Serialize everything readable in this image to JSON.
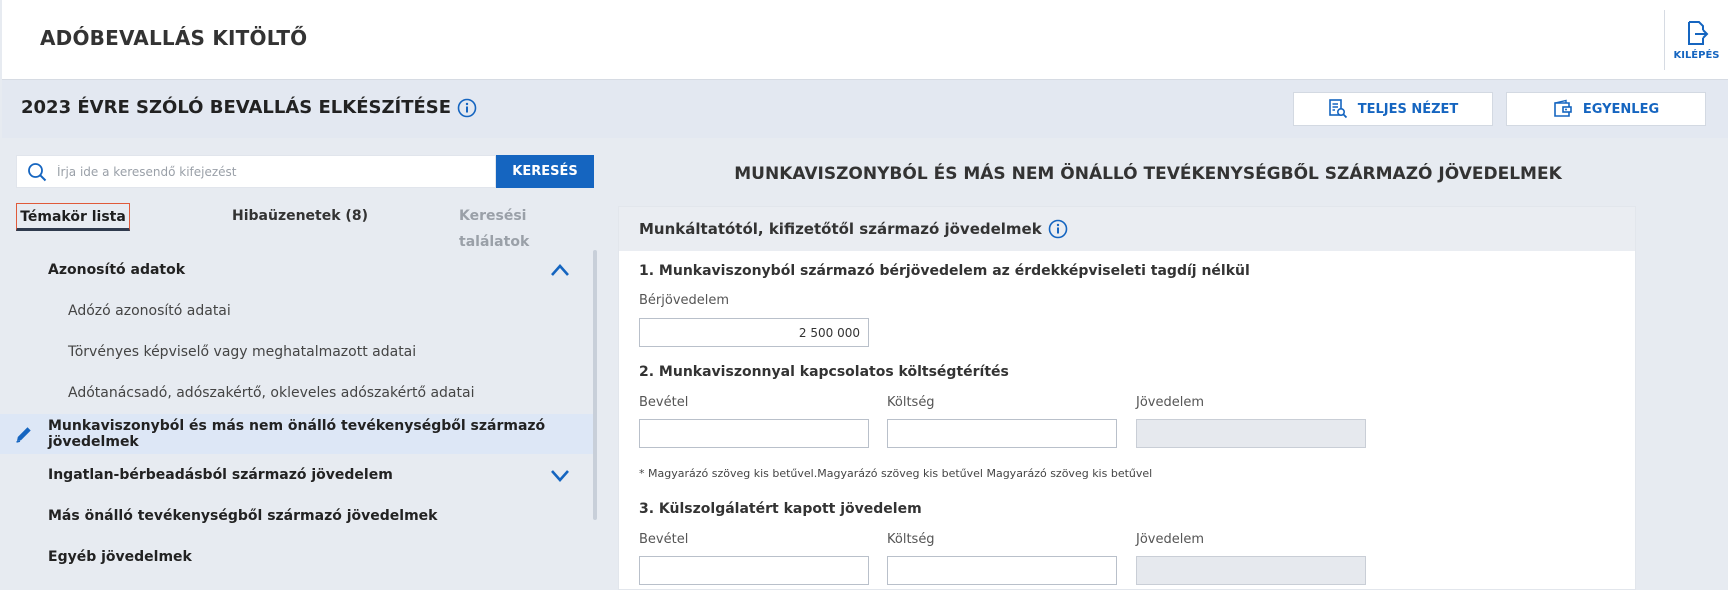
{
  "app": {
    "title": "ADÓBEVALLÁS KITÖLTŐ",
    "logout_label": "KILÉPÉS"
  },
  "header": {
    "title": "2023 ÉVRE SZÓLÓ BEVALLÁS ELKÉSZÍTÉSE",
    "full_view_label": "TELJES NÉZET",
    "balance_label": "EGYENLEG"
  },
  "search": {
    "placeholder": "Írja ide a keresendő kifejezést",
    "value": "",
    "button_label": "KERESÉS"
  },
  "tabs": [
    {
      "label": "Témakör lista",
      "active": true
    },
    {
      "label": "Hibaüzenetek (8)",
      "active": false
    },
    {
      "label": "Keresési találatok",
      "active": false
    }
  ],
  "nav": [
    {
      "label": "Azonosító adatok",
      "type": "group",
      "expanded": true
    },
    {
      "label": "Adózó azonosító adatai",
      "type": "sub"
    },
    {
      "label": "Törvényes képviselő vagy meghatalmazott adatai",
      "type": "sub"
    },
    {
      "label": "Adótanácsadó, adószakértő, okleveles adószakértő adatai",
      "type": "sub"
    },
    {
      "label": "Munkaviszonyból és más nem önálló tevékenységből származó jövedelmek",
      "type": "group",
      "active": true
    },
    {
      "label": "Ingatlan-bérbeadásból származó jövedelem",
      "type": "group",
      "expanded": false
    },
    {
      "label": "Más önálló tevékenységből származó jövedelmek",
      "type": "group"
    },
    {
      "label": "Egyéb jövedelmek",
      "type": "group"
    }
  ],
  "main": {
    "title": "MUNKAVISZONYBÓL ÉS MÁS NEM ÖNÁLLÓ TEVÉKENYSÉGBŐL SZÁRMAZÓ JÖVEDELMEK",
    "card_title": "Munkáltatótól, kifizetőtől származó jövedelmek",
    "q1": {
      "title": "1. Munkaviszonyból származó bérjövedelem az érdekképviseleti tagdíj nélkül",
      "label": "Bérjövedelem",
      "value": "2 500 000"
    },
    "q2": {
      "title": "2. Munkaviszonnyal kapcsolatos költségtérítés",
      "labels": [
        "Bevétel",
        "Költség",
        "Jövedelem"
      ],
      "values": [
        "",
        "",
        ""
      ],
      "note": "* Magyarázó szöveg kis betűvel.Magyarázó szöveg kis betűvel Magyarázó szöveg kis betűvel"
    },
    "q3": {
      "title": "3. Külszolgálatért kapott jövedelem",
      "labels": [
        "Bevétel",
        "Költség",
        "Jövedelem"
      ],
      "values": [
        "",
        "",
        ""
      ]
    }
  },
  "colors": {
    "accent": "#1565c0",
    "active_bg": "#dde7f6",
    "header_bg": "#e3e8f1"
  }
}
